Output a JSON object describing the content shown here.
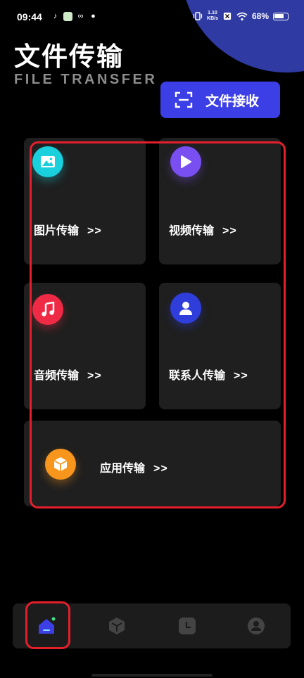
{
  "status_bar": {
    "time": "09:44",
    "net_speed_value": "1.10",
    "net_speed_unit": "KB/s",
    "battery": "68%",
    "icons": [
      "tiktok-icon",
      "app-icon",
      "link-icon",
      "wechat-icon",
      "vibrate-icon",
      "sim-off-icon",
      "wifi-icon",
      "battery-icon"
    ]
  },
  "header": {
    "title": "文件传输",
    "subtitle": "FILE TRANSFER"
  },
  "receive_button": {
    "label": "文件接收",
    "icon": "scan-icon",
    "color": "#3b3fe5"
  },
  "cards": [
    {
      "label": "图片传输",
      "arrow": ">>",
      "icon": "image-icon",
      "color": "#19d0dc"
    },
    {
      "label": "视频传输",
      "arrow": ">>",
      "icon": "play-icon",
      "color": "#7a4ff2"
    },
    {
      "label": "音频传输",
      "arrow": ">>",
      "icon": "music-icon",
      "color": "#ef2a45"
    },
    {
      "label": "联系人传输",
      "arrow": ">>",
      "icon": "contact-icon",
      "color": "#2f3ddb"
    },
    {
      "label": "应用传输",
      "arrow": ">>",
      "icon": "app-box-icon",
      "color": "#f7951d"
    }
  ],
  "bottom_nav": {
    "items": [
      {
        "icon": "home-icon",
        "active": true,
        "color": "#3b3fe5"
      },
      {
        "icon": "box-icon",
        "active": false
      },
      {
        "icon": "history-icon",
        "active": false
      },
      {
        "icon": "profile-icon",
        "active": false
      }
    ]
  },
  "highlight_color": "#e41f2c"
}
